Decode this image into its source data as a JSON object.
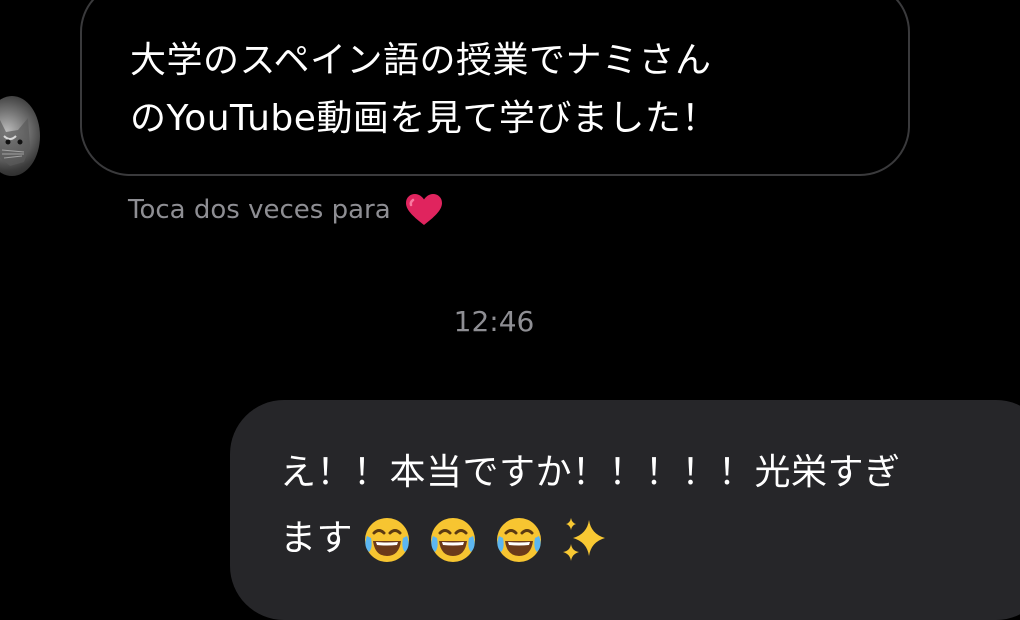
{
  "conversation": {
    "received": {
      "lines": [
        "大学のスペイン語の授業でナミさん",
        "のYouTube動画を見て学びました！"
      ],
      "reaction_hint": "Toca dos veces para"
    },
    "timestamp": "12:46",
    "sent": {
      "lines": [
        "え！！本当ですか！！！！！光栄すぎ",
        "ます"
      ],
      "emojis": [
        "face-with-tears-of-joy-icon",
        "face-with-tears-of-joy-icon",
        "face-with-tears-of-joy-icon",
        "sparkles-icon"
      ]
    }
  },
  "colors": {
    "background": "#000000",
    "received_border": "#3a3a3c",
    "sent_bubble": "#262629",
    "secondary_text": "#8e8e93",
    "heart": "#e0245e"
  }
}
